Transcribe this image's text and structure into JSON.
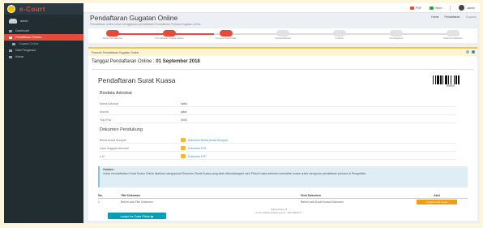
{
  "app": {
    "logo_text": "e-Court",
    "user_name": "admin"
  },
  "sidebar": {
    "items": [
      {
        "label": "Dashboard",
        "active": false,
        "sub": false
      },
      {
        "label": "Pendaftaran Perkara",
        "active": true,
        "sub": false
      },
      {
        "label": "Gugatan Online",
        "active": false,
        "sub": true
      },
      {
        "label": "Data Pengacara",
        "active": false,
        "sub": false
      },
      {
        "label": "Keluar",
        "active": false,
        "sub": false
      }
    ]
  },
  "topbar": {
    "pdf_label": "PDF",
    "word_label": "Word",
    "user_label": "admin"
  },
  "header": {
    "title": "Pendaftaran Gugatan Online",
    "subtitle": "Pendaftaran online untuk mengajukan pendaftaran Pendaftaran Perkara Gugatan online",
    "breadcrumbs": [
      "Home",
      "Pendaftaran",
      "Gugatan"
    ]
  },
  "stepper": {
    "steps": [
      {
        "label": "Mulai Pendaftaran",
        "done": true
      },
      {
        "label": "Pendaftaran Kuasa Wakaf",
        "done": true
      },
      {
        "label": "Pengisi Data Pihak",
        "done": true
      },
      {
        "label": "Upload Berkas",
        "done": false
      },
      {
        "label": "e-Skum",
        "done": false
      },
      {
        "label": "Pembayaran",
        "done": false
      },
      {
        "label": "Data Pendaftaran",
        "done": false
      }
    ]
  },
  "form": {
    "header": "Formulir Pendaftaran Gugatan Online",
    "date_label": "Tanggal Pendaftaran Online : ",
    "date_value": "01 September 2018",
    "title": "Pendaftaran Surat Kuasa",
    "barcode_text": "0000002",
    "advokat": {
      "title": "Biodata Advokat",
      "rows": [
        {
          "key": "Nama Advokat",
          "value": "sidiki"
        },
        {
          "key": "Alamat",
          "value": "jakar"
        },
        {
          "key": "Telp./Fax",
          "value": "0000"
        }
      ]
    },
    "dokumen": {
      "title": "Dokumen Pendukung",
      "rows": [
        {
          "key": "Berita Acara Sumpah",
          "value": "Dokumen Berita Acara Sumpah"
        },
        {
          "key": "Kartu Anggota Advokat",
          "value": "Dokumen KTA"
        },
        {
          "key": "e-KI",
          "value": "Dokumen KTP"
        }
      ]
    },
    "note_title": "Catatan :",
    "note_text": "Untuk mendaftarkan Surat Kuasa Online silahkan mengupload Dokumen Surat Kuasa yang telah ditandatangani oleh Pihak Kuasa sebelum mendaftar kuasa untuk mengurus pendaftaran perkara di Pengadilan.",
    "table": {
      "headers": [
        "No.",
        "Title Dokumen",
        "View Dokumen",
        "Aksi"
      ],
      "rows": [
        {
          "no": "1",
          "title": "Belum ada Title Dokumen",
          "view": "Belum ada Surat Kuasa Dokumen",
          "action": "Upload Surat Kuasa"
        }
      ]
    },
    "footer_note_1": "Hubungi kami di",
    "footer_note_2": "ecourt.mahkamahagung.go.id - 021-29079177",
    "next_button": "Lanjut ke Data Pihak"
  }
}
